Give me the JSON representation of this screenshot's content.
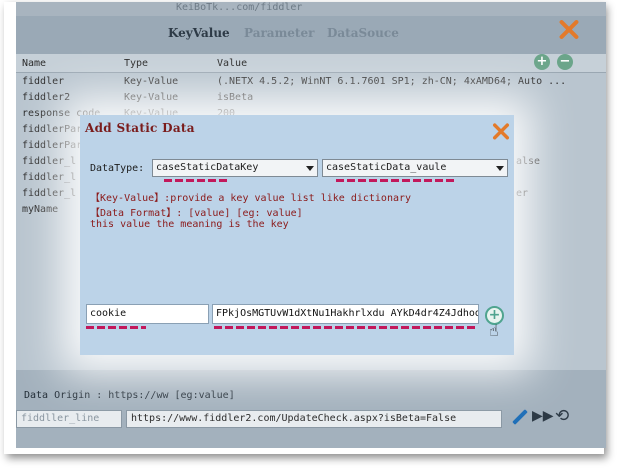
{
  "top": {
    "url": "KeiBoTk...com/fiddler"
  },
  "tabs": [
    {
      "label": "KeyValue",
      "active": true
    },
    {
      "label": "Parameter",
      "active": false
    },
    {
      "label": "DataSouce",
      "active": false
    }
  ],
  "table": {
    "columns": [
      "Name",
      "Type",
      "Value"
    ],
    "rows": [
      {
        "name": "fiddler",
        "type": "Key-Value",
        "value": "(.NETX 4.5.2; WinNT 6.1.7601 SP1; zh-CN; 4xAMD64; Auto ..."
      },
      {
        "name": "fiddler2",
        "type": "Key-Value",
        "value": "isBeta"
      },
      {
        "name": "response code",
        "type": "Key-Value",
        "value": "200"
      },
      {
        "name": "fiddlerPar",
        "type": "",
        "value": ""
      },
      {
        "name": "fiddlerPar",
        "type": "",
        "value": ""
      },
      {
        "name": "fiddler_l",
        "type": "",
        "value": ""
      },
      {
        "name": "fiddler_l",
        "type": "",
        "value": ""
      },
      {
        "name": "fiddler_l",
        "type": "",
        "value": ""
      },
      {
        "name": "myName",
        "type": "",
        "value": ""
      }
    ],
    "right_fragments": [
      "alse",
      "er"
    ]
  },
  "table_buttons": {
    "add": "+",
    "remove": "−"
  },
  "bottom": {
    "origin_label": "Data Origin : https://ww [eg:value]",
    "name_placeholder": "fiddller_line",
    "url_value": "https://www.fiddler2.com/UpdateCheck.aspx?isBeta=False"
  },
  "dialog": {
    "title": "Add Static Data",
    "datatype_label": "DataType:",
    "select1": "caseStaticDataKey",
    "select2": "caseStaticData_vaule",
    "info_lines": [
      "【Key-Value】:provide a key value list like dictionary",
      "【Data Format】: [value] [eg: value]",
      "this value the meaning is the key"
    ],
    "key_input": "cookie",
    "value_input": "FPkjOsMGTUvW1dXtNu1Hakhrlxdu AYkD4dr4Z4Jdhod",
    "add_label": "+"
  },
  "colors": {
    "accent_orange": "#e37a2a",
    "dialog_bg": "#bcd3e8",
    "annotation_pink": "#c2185b",
    "add_green": "#4fa48f"
  },
  "icons": [
    "close-icon",
    "add-icon",
    "remove-icon",
    "pencil-icon",
    "fast-forward-icon",
    "reset-icon",
    "hand-cursor-icon"
  ]
}
